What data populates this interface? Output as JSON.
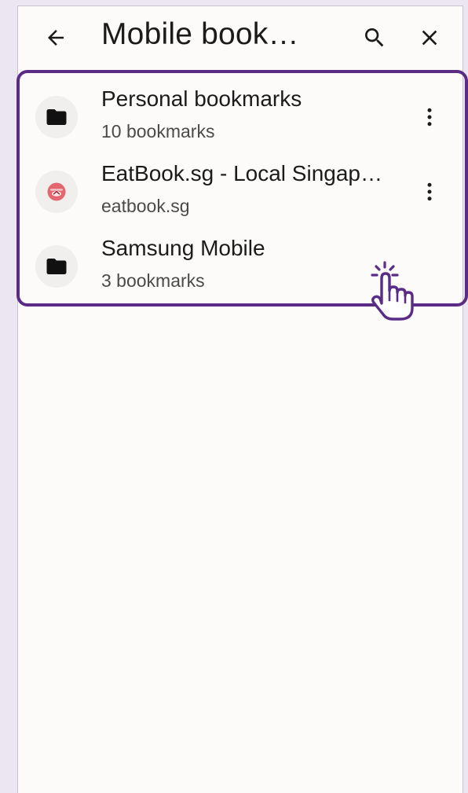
{
  "appbar": {
    "title": "Mobile book…",
    "back_icon": "arrow-back-icon",
    "search_icon": "search-icon",
    "close_icon": "close-icon"
  },
  "bookmarks": [
    {
      "title": "Personal bookmarks",
      "subtitle": "10 bookmarks",
      "icon": "folder-icon",
      "has_menu": true
    },
    {
      "title": "EatBook.sg - Local Singap…",
      "subtitle": "eatbook.sg",
      "icon": "site-favicon-icon",
      "has_menu": true
    },
    {
      "title": "Samsung Mobile",
      "subtitle": "3 bookmarks",
      "icon": "folder-icon",
      "has_menu": false
    }
  ],
  "colors": {
    "highlight": "#5b2c86",
    "background": "#ece6f2",
    "surface": "#fcfbfa"
  }
}
